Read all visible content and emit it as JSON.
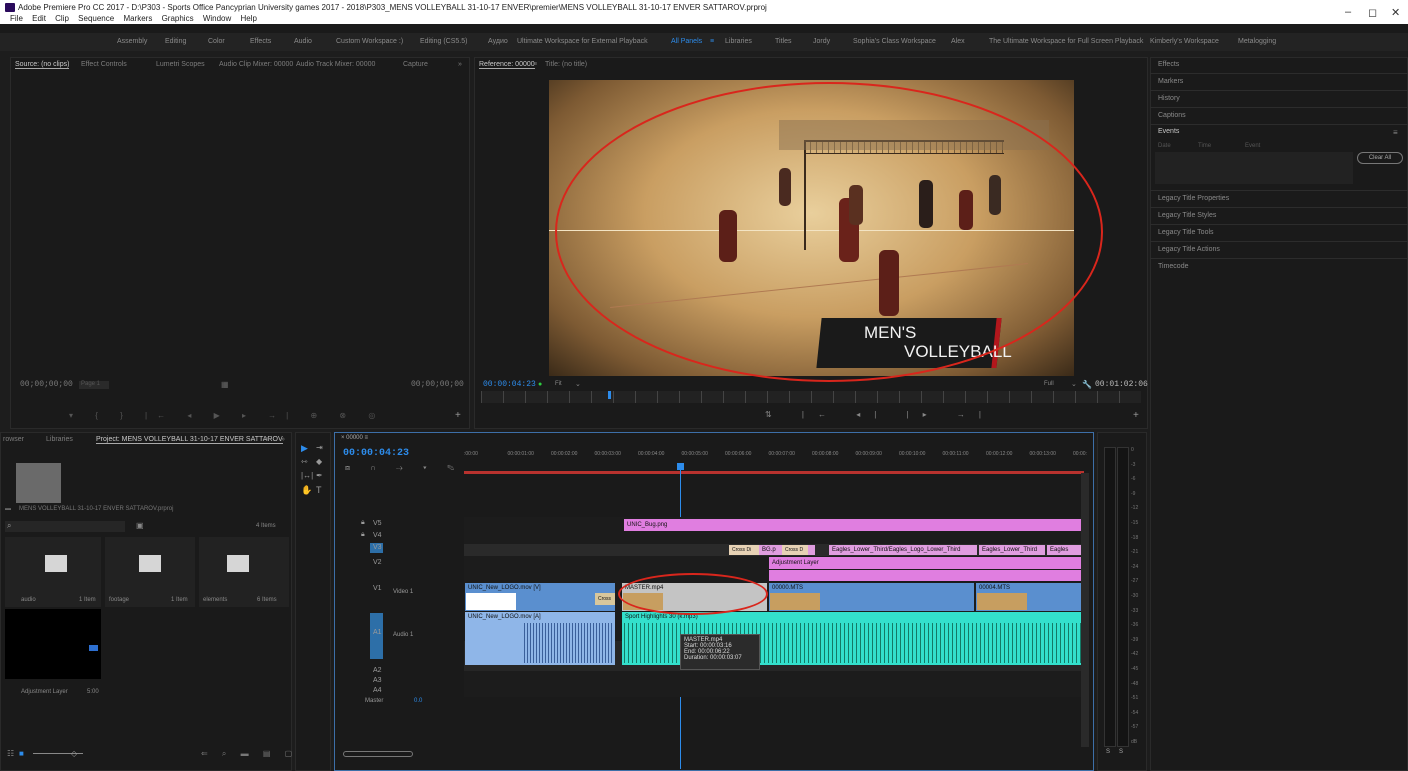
{
  "app": {
    "title": "Adobe Premiere Pro CC 2017 - D:\\P303 - Sports Office Pancyprian University games 2017 - 2018\\P303_MENS VOLLEYBALL 31-10-17 ENVER\\premier\\MENS VOLLEYBALL 31-10-17 ENVER SATTAROV.prproj",
    "menu": [
      "File",
      "Edit",
      "Clip",
      "Sequence",
      "Markers",
      "Graphics",
      "Window",
      "Help"
    ],
    "window_controls": [
      "–",
      "◻",
      "✕"
    ]
  },
  "workspaces": [
    "Assembly",
    "Editing",
    "Color",
    "Effects",
    "Audio",
    "Custom Workspace :)",
    "Editing (CS5.5)",
    "Аудио",
    "Ultimate Workspace for External Playback",
    "All Panels",
    "Libraries",
    "Titles",
    "Jordy",
    "Sophia's Class Workspace",
    "Alex",
    "The Ultimate Workspace for Full Screen Playback",
    "Kimberly's Workspace",
    "Metalogging"
  ],
  "active_workspace": "All Panels",
  "source_panel": {
    "tabs": [
      "Source: (no clips)",
      "Effect Controls",
      "Lumetri Scopes",
      "Audio Clip Mixer: 00000",
      "Audio Track Mixer: 00000",
      "Capture"
    ],
    "timecode_left": "00;00;00;00",
    "timecode_right": "00;00;00;00",
    "page": "Page 1"
  },
  "reference_panel": {
    "tabs": [
      "Reference: 00000",
      "Title: (no title)"
    ],
    "timecode": "00:00:04:23",
    "fit": "Fit",
    "quality": "Full",
    "duration": "00:01:02:06",
    "overlay_line1": "MEN'S",
    "overlay_line2": "VOLLEYBALL"
  },
  "right_panel": {
    "items_top": [
      "Effects",
      "Markers",
      "History",
      "Captions",
      "Events"
    ],
    "event_columns": [
      "Date",
      "Time",
      "Event"
    ],
    "clear_all": "Clear All",
    "items_bottom": [
      "Legacy Title Properties",
      "Legacy Title Styles",
      "Legacy Title Tools",
      "Legacy Title Actions",
      "Timecode"
    ]
  },
  "project_panel": {
    "tabs": [
      "rowser",
      "Libraries",
      "Project: MENS VOLLEYBALL 31-10-17 ENVER SATTAROV"
    ],
    "project_file": "MENS VOLLEYBALL 31-10-17 ENVER SATTAROV.prproj",
    "item_count": "4 Items",
    "bins": [
      {
        "name": "audio",
        "count": "1 Item"
      },
      {
        "name": "footage",
        "count": "1 Item"
      },
      {
        "name": "elements",
        "count": "6 Items"
      }
    ],
    "adjustment": {
      "name": "Adjustment Layer",
      "duration": "5:00"
    }
  },
  "timeline": {
    "sequence": "00000",
    "timecode": "00:00:04:23",
    "ruler": [
      ":00:00",
      "00:00:01:00",
      "00:00:02:00",
      "00:00:03:00",
      "00:00:04:00",
      "00:00:05:00",
      "00:00:06:00",
      "00:00:07:00",
      "00:00:08:00",
      "00:00:09:00",
      "00:00:10:00",
      "00:00:11:00",
      "00:00:12:00",
      "00:00:13:00",
      "00:00:"
    ],
    "video_tracks": [
      "V5",
      "V4",
      "V3",
      "V2",
      "V1"
    ],
    "audio_tracks": [
      "A1",
      "A2",
      "A3",
      "A4"
    ],
    "v1_name": "Video 1",
    "a1_name": "Audio 1",
    "master": "Master",
    "master_value": "0.0",
    "clips": {
      "v5": "UNIC_Bug.png",
      "v3_bg": "BG.p",
      "v3_cross1": "Cross Di",
      "v3_cross2": "Cross D",
      "v3_lower1": "Eagles_Lower_Third/Eagles_Logo_Lower_Third",
      "v3_lower2": "Eagles_Lower_Third",
      "v3_lower3": "Eagles",
      "v2_adj": "Adjustment Layer",
      "v1_logo": "UNIC_New_LOGO.mov [V]",
      "v1_cross": "Cross",
      "v1_master": "MASTER.mp4",
      "v1_mts1": "00000.MTS",
      "v1_mts2": "00004.MTS",
      "a1_logo": "UNIC_New_LOGO.mov [A]",
      "a1_music": "Sport Highlights 30 (k.mp3)"
    },
    "tooltip": [
      "MASTER.mp4",
      "Start: 00:00:03:16",
      "End: 00:00:06:22",
      "Duration: 00:00:03:07"
    ]
  },
  "meter": {
    "scale": [
      "0",
      "-3",
      "-6",
      "-9",
      "-12",
      "-15",
      "-18",
      "-21",
      "-24",
      "-27",
      "-30",
      "-33",
      "-36",
      "-39",
      "-42",
      "-45",
      "-48",
      "-51",
      "-54",
      "-57",
      "dB"
    ],
    "solo": [
      "S",
      "S"
    ]
  },
  "colors": {
    "accent": "#2d8ceb",
    "v5_clip": "#e07ee0",
    "v3_clip": "#e09de0",
    "v1_clip": "#5a8fcf",
    "audio_clip": "#33e0cc",
    "audio_logo": "#8fb6e8",
    "annotation": "#d9261c"
  }
}
